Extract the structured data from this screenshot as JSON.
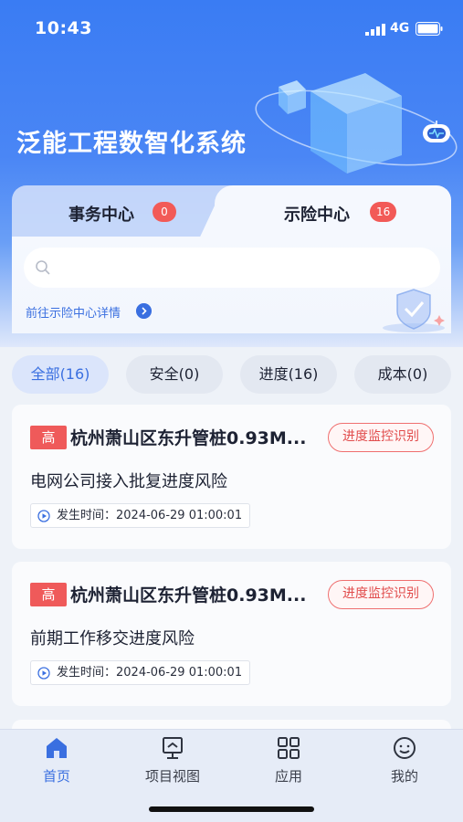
{
  "status_bar": {
    "time": "10:43",
    "network": "4G"
  },
  "app": {
    "title": "泛能工程数智化系统"
  },
  "tabs": [
    {
      "label": "事务中心",
      "badge": "0"
    },
    {
      "label": "示险中心",
      "badge": "16",
      "active": true
    }
  ],
  "search": {
    "placeholder": ""
  },
  "detail_link": {
    "label": "前往示险中心详情"
  },
  "filters": [
    {
      "label": "全部(16)",
      "active": true
    },
    {
      "label": "安全(0)"
    },
    {
      "label": "进度(16)"
    },
    {
      "label": "成本(0)"
    }
  ],
  "risks": [
    {
      "level": "高",
      "project": "杭州萧山区东升管桩0.93M...",
      "source": "进度监控识别",
      "title": "电网公司接入批复进度风险",
      "time_label": "发生时间：",
      "time": "2024-06-29 01:00:01"
    },
    {
      "level": "高",
      "project": "杭州萧山区东升管桩0.93M...",
      "source": "进度监控识别",
      "title": "前期工作移交进度风险",
      "time_label": "发生时间：",
      "time": "2024-06-29 01:00:01"
    }
  ],
  "bottom_nav": [
    {
      "label": "首页",
      "icon": "home-icon",
      "active": true
    },
    {
      "label": "项目视图",
      "icon": "project-view-icon"
    },
    {
      "label": "应用",
      "icon": "apps-grid-icon"
    },
    {
      "label": "我的",
      "icon": "profile-smile-icon"
    }
  ],
  "colors": {
    "primary": "#3a6fe0",
    "danger": "#ef5a5a",
    "header_blue": "#3a7cf3"
  }
}
